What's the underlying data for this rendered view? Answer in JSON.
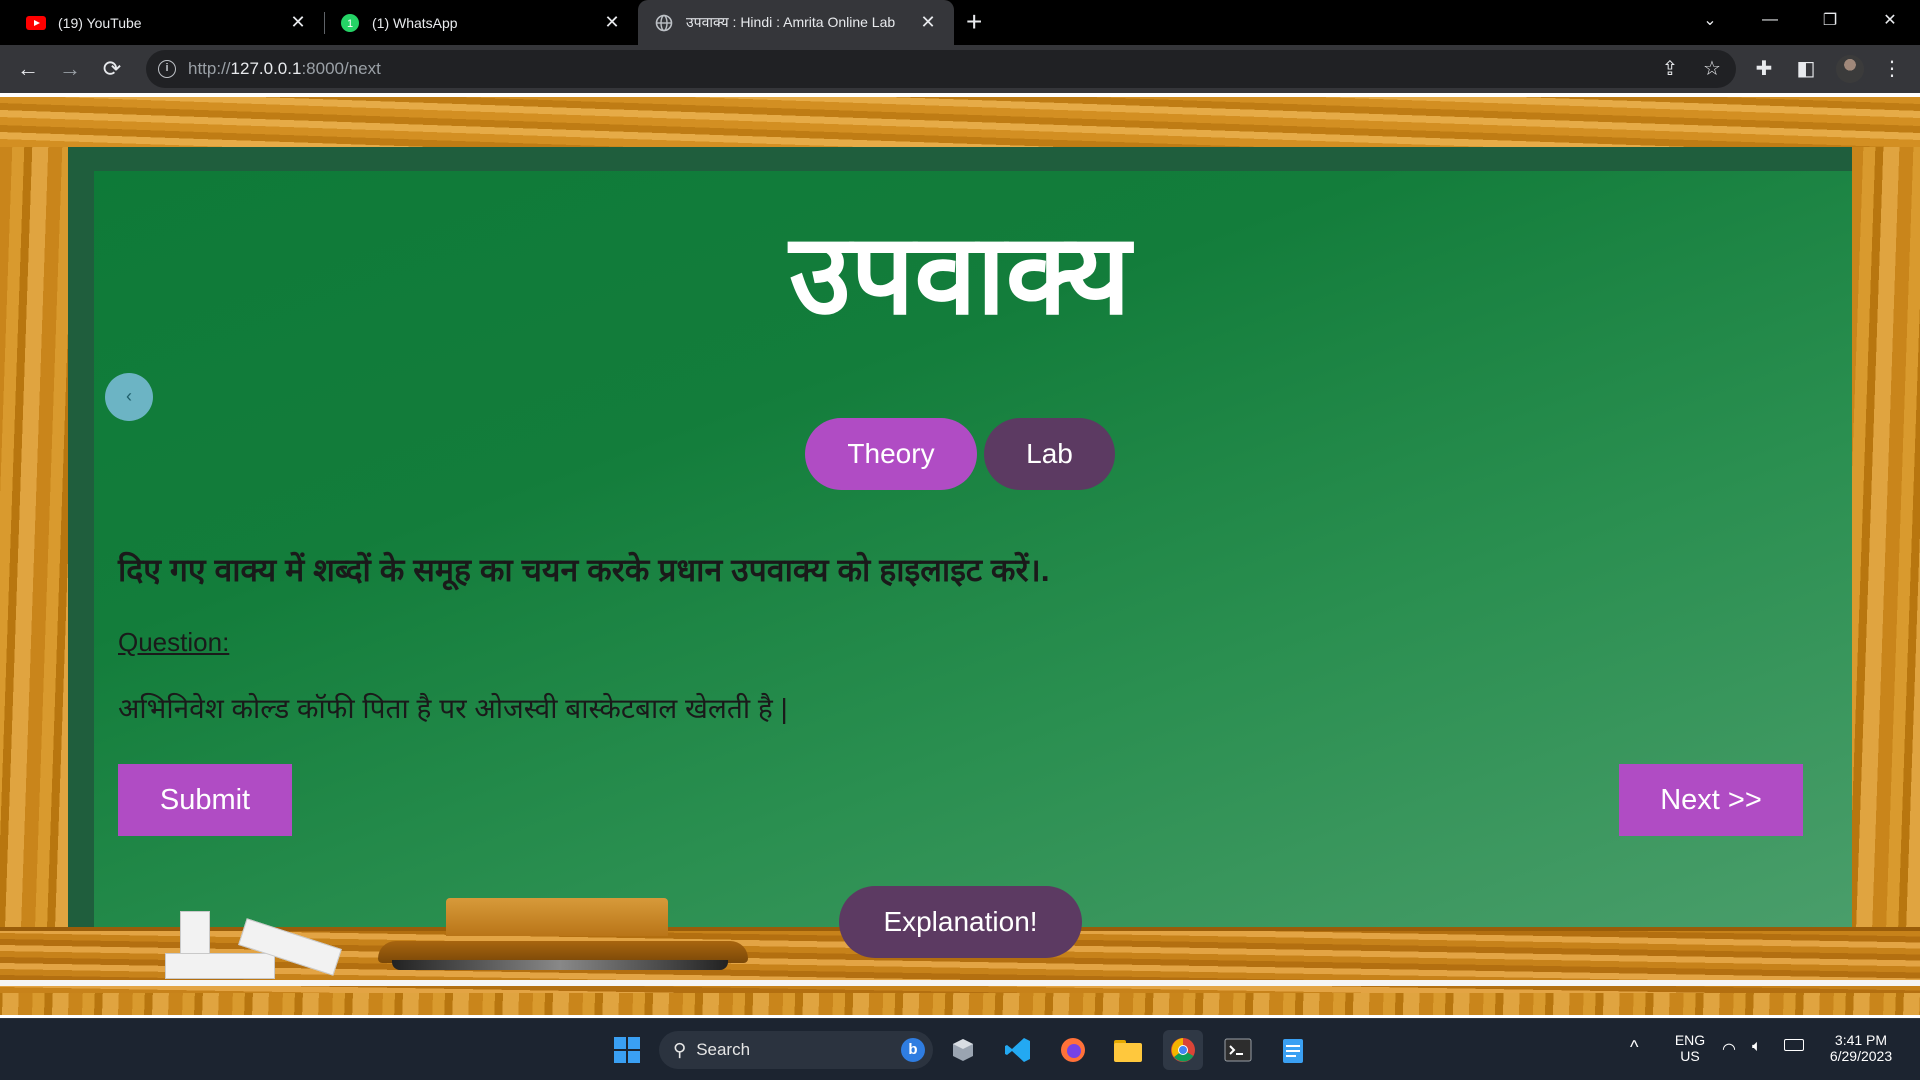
{
  "browser": {
    "tabs": [
      {
        "title": "(19) YouTube",
        "icon": "youtube-icon",
        "active": false
      },
      {
        "title": "(1) WhatsApp",
        "icon": "whatsapp-icon",
        "active": false
      },
      {
        "title": "उपवाक्य : Hindi : Amrita Online Lab",
        "icon": "globe-icon",
        "active": true
      }
    ],
    "url_prefix": "http://",
    "url_host": "127.0.0.1",
    "url_rest": ":8000/next"
  },
  "page": {
    "heading": "उपवाक्य",
    "back_symbol": "‹",
    "tabs": {
      "theory": "Theory",
      "lab": "Lab"
    },
    "instruction": "दिए गए वाक्य में शब्दों के समूह का चयन करके प्रधान उपवाक्य को हाइलाइट करें।.",
    "question_label": "Question:",
    "question_text": "अभिनिवेश कोल्ड कॉफी पिता है पर ओजस्वी बास्केटबाल खेलती है |",
    "submit_label": "Submit",
    "next_label": "Next >>",
    "explanation_label": "Explanation!"
  },
  "taskbar": {
    "search_placeholder": "Search",
    "language": "ENG",
    "region": "US",
    "time": "3:41 PM",
    "date": "6/29/2023"
  },
  "colors": {
    "board_green": "#137d3b",
    "button_purple": "#b04cc4",
    "button_dark_purple": "#5c3a62",
    "wood": "#d38f22"
  }
}
